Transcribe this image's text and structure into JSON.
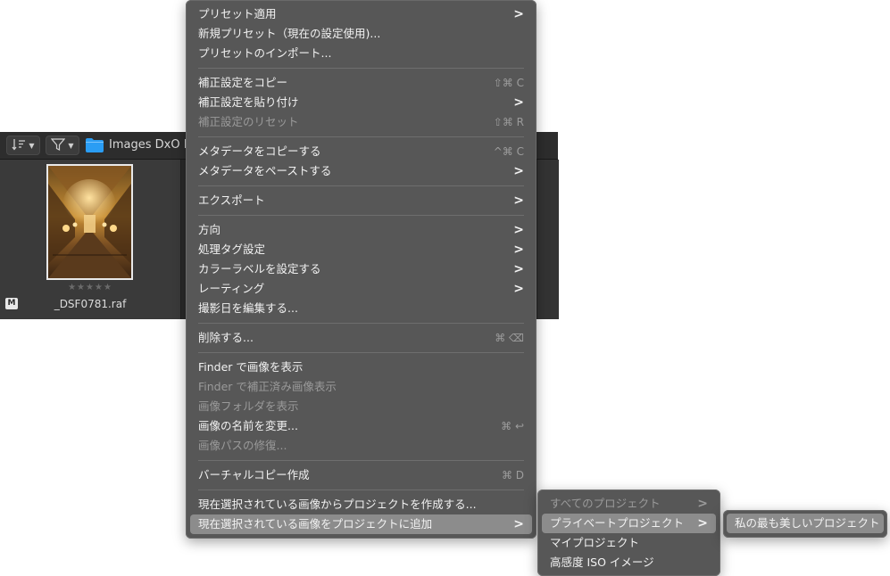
{
  "browser": {
    "folder_name": "Images DxO Ph",
    "thumbnail": {
      "stars": "★★★★★",
      "badge": "M",
      "filename": "_DSF0781.raf"
    }
  },
  "context_menu": {
    "groups": [
      [
        {
          "label": "プリセット適用",
          "arrow": ">",
          "shortcut": "",
          "disabled": false
        },
        {
          "label": "新規プリセット（現在の設定使用)...",
          "arrow": "",
          "shortcut": "",
          "disabled": false
        },
        {
          "label": "プリセットのインポート...",
          "arrow": "",
          "shortcut": "",
          "disabled": false
        }
      ],
      [
        {
          "label": "補正設定をコピー",
          "arrow": "",
          "shortcut": "⇧⌘ C",
          "disabled": false
        },
        {
          "label": "補正設定を貼り付け",
          "arrow": ">",
          "shortcut": "",
          "disabled": false
        },
        {
          "label": "補正設定のリセット",
          "arrow": "",
          "shortcut": "⇧⌘ R",
          "disabled": true
        }
      ],
      [
        {
          "label": "メタデータをコピーする",
          "arrow": "",
          "shortcut": "^⌘ C",
          "disabled": false
        },
        {
          "label": "メタデータをペーストする",
          "arrow": ">",
          "shortcut": "",
          "disabled": false
        }
      ],
      [
        {
          "label": "エクスポート",
          "arrow": ">",
          "shortcut": "",
          "disabled": false
        }
      ],
      [
        {
          "label": "方向",
          "arrow": ">",
          "shortcut": "",
          "disabled": false
        },
        {
          "label": "処理タグ設定",
          "arrow": ">",
          "shortcut": "",
          "disabled": false
        },
        {
          "label": "カラーラベルを設定する",
          "arrow": ">",
          "shortcut": "",
          "disabled": false
        },
        {
          "label": "レーティング",
          "arrow": ">",
          "shortcut": "",
          "disabled": false
        },
        {
          "label": "撮影日を編集する...",
          "arrow": "",
          "shortcut": "",
          "disabled": false
        }
      ],
      [
        {
          "label": "削除する...",
          "arrow": "",
          "shortcut": "⌘ ⌫",
          "disabled": false
        }
      ],
      [
        {
          "label": "Finder で画像を表示",
          "arrow": "",
          "shortcut": "",
          "disabled": false
        },
        {
          "label": "Finder で補正済み画像表示",
          "arrow": "",
          "shortcut": "",
          "disabled": true
        },
        {
          "label": "画像フォルダを表示",
          "arrow": "",
          "shortcut": "",
          "disabled": true
        },
        {
          "label": "画像の名前を変更...",
          "arrow": "",
          "shortcut": "⌘ ↩",
          "disabled": false
        },
        {
          "label": "画像パスの修復...",
          "arrow": "",
          "shortcut": "",
          "disabled": true
        }
      ],
      [
        {
          "label": "バーチャルコピー作成",
          "arrow": "",
          "shortcut": "⌘ D",
          "disabled": false
        }
      ],
      [
        {
          "label": "現在選択されている画像からプロジェクトを作成する...",
          "arrow": "",
          "shortcut": "",
          "disabled": false
        },
        {
          "label": "現在選択されている画像をプロジェクトに追加",
          "arrow": ">",
          "shortcut": "",
          "disabled": false,
          "highlight": true
        }
      ]
    ]
  },
  "submenu": [
    {
      "label": "すべてのプロジェクト",
      "arrow": ">",
      "disabled": true
    },
    {
      "label": "プライベートプロジェクト",
      "arrow": ">",
      "disabled": false,
      "highlight": true
    },
    {
      "label": "マイプロジェクト",
      "arrow": "",
      "disabled": false
    },
    {
      "label": "高感度 ISO イメージ",
      "arrow": "",
      "disabled": false
    }
  ],
  "submenu2": [
    {
      "label": "私の最も美しいプロジェクト",
      "highlight": true
    }
  ],
  "colors": {
    "menu_bg": "#575757",
    "highlight_bg": "#8c8c8c",
    "folder_blue": "#2a9df4"
  }
}
